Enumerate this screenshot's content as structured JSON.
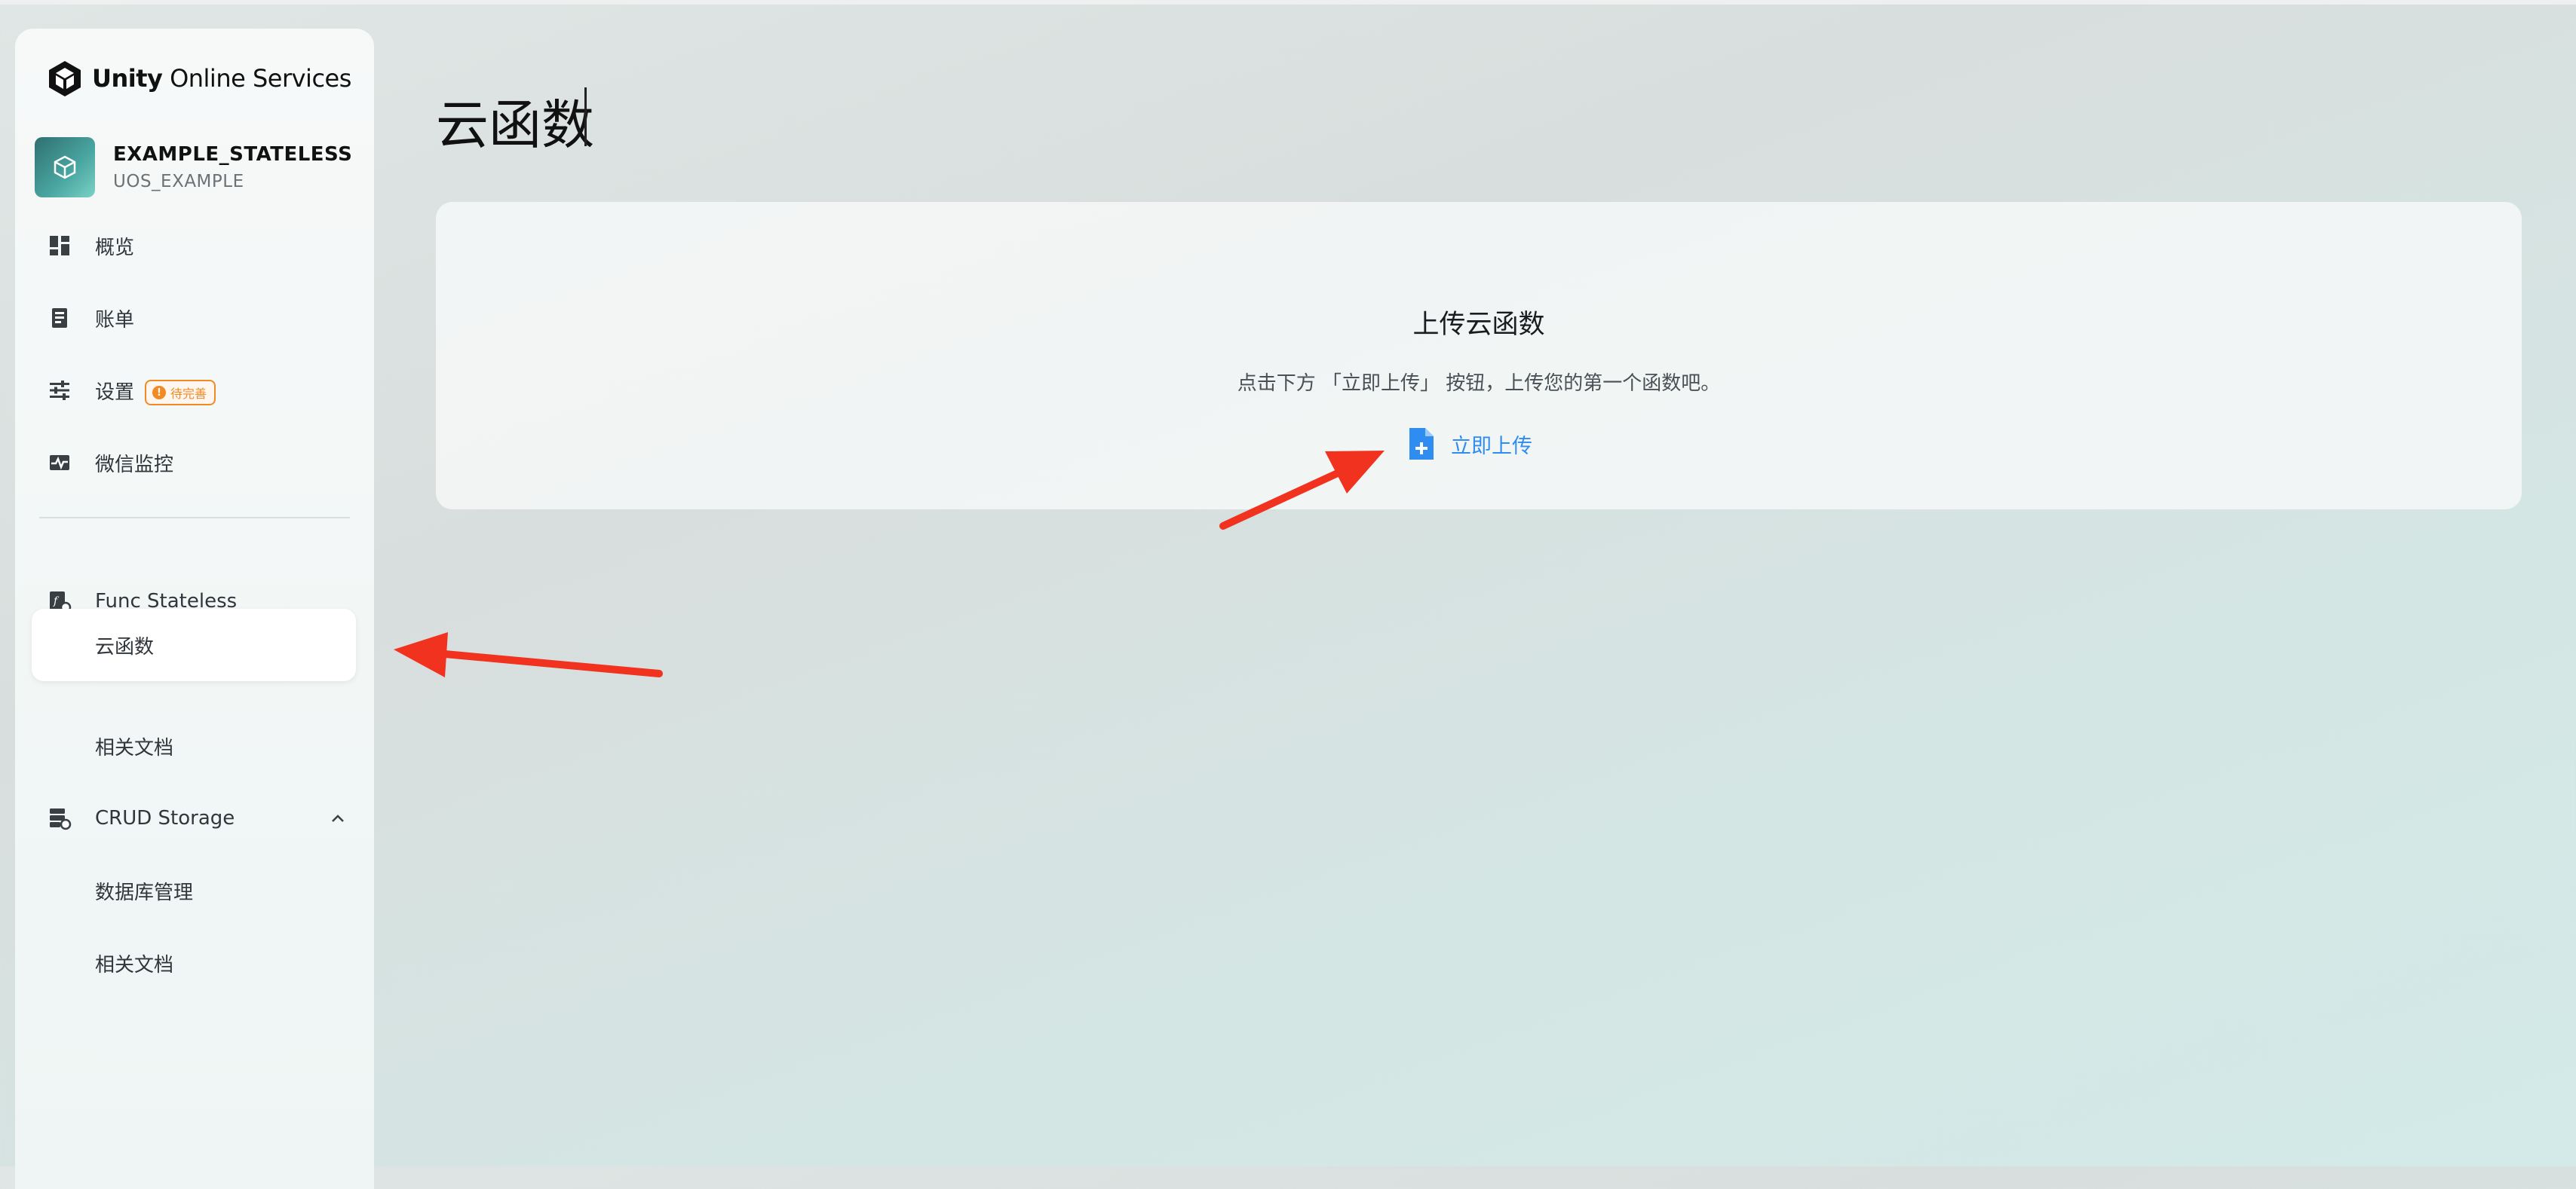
{
  "brand": {
    "bold": "Unity",
    "rest": " Online Services"
  },
  "project": {
    "name": "EXAMPLE_STATELESS",
    "sub": "UOS_EXAMPLE"
  },
  "nav": {
    "overview": "概览",
    "billing": "账单",
    "settings": "设置",
    "settings_badge": "待完善",
    "wechat_monitor": "微信监控",
    "func_stateless": "Func Stateless",
    "cloud_functions": "云函数",
    "func_docs": "相关文档",
    "crud_storage": "CRUD Storage",
    "db_management": "数据库管理",
    "crud_docs": "相关文档"
  },
  "main": {
    "title": "云函数",
    "card_title": "上传云函数",
    "card_desc": "点击下方 「立即上传」 按钮，上传您的第一个函数吧。",
    "upload_label": "立即上传"
  },
  "colors": {
    "accent": "#2f8cf0",
    "badge": "#f08a24",
    "annotation_arrow": "#f0321f"
  }
}
